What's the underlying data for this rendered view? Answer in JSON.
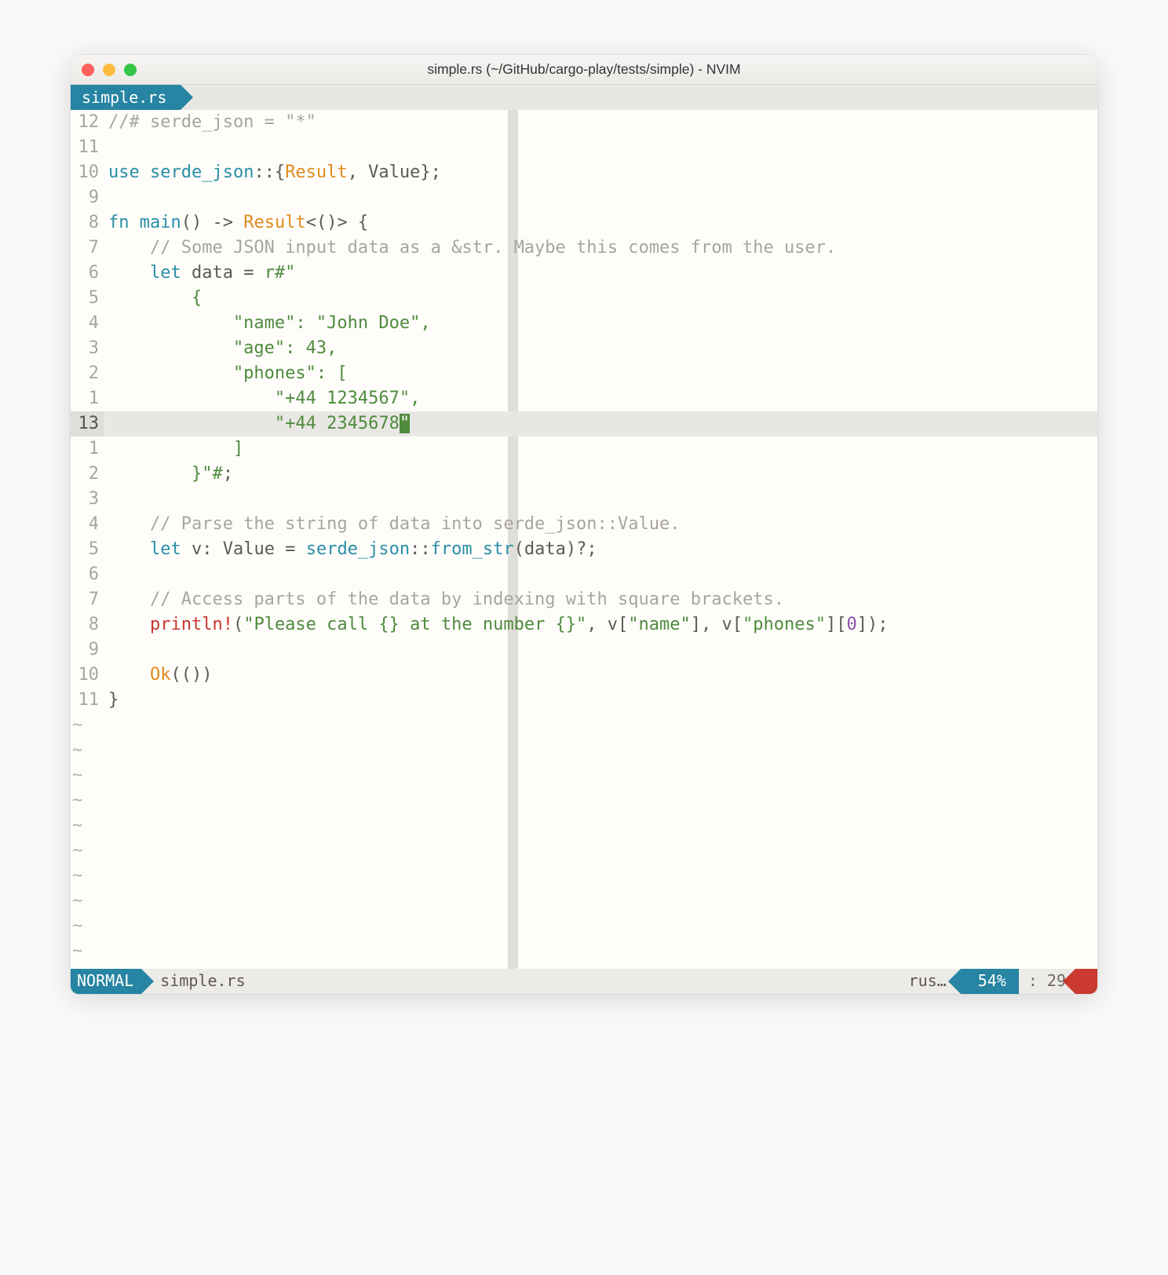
{
  "window": {
    "title": "simple.rs (~/GitHub/cargo-play/tests/simple) - NVIM"
  },
  "tab": {
    "label": "simple.rs"
  },
  "cursor": {
    "line_index": 12,
    "col": 29
  },
  "gutter_numbers": [
    "12",
    "11",
    "10",
    "9",
    "8",
    "7",
    "6",
    "5",
    "4",
    "3",
    "2",
    "1",
    "13",
    "1",
    "2",
    "3",
    "4",
    "5",
    "6",
    "7",
    "8",
    "9",
    "10",
    "11"
  ],
  "tilde_count": 10,
  "statusbar": {
    "mode": "NORMAL",
    "file": "simple.rs",
    "filetype": "rus…",
    "percent": "54%",
    "position": ": 29"
  },
  "code_lines": [
    [
      {
        "t": "//# serde_json = \"*\"",
        "c": "c-gray"
      }
    ],
    [],
    [
      {
        "t": "use ",
        "c": "c-teal"
      },
      {
        "t": "serde_json",
        "c": "c-teal"
      },
      {
        "t": "::{",
        "c": "c-text"
      },
      {
        "t": "Result",
        "c": "c-orange"
      },
      {
        "t": ", ",
        "c": "c-text"
      },
      {
        "t": "Value",
        "c": "c-text"
      },
      {
        "t": "};",
        "c": "c-text"
      }
    ],
    [],
    [
      {
        "t": "fn ",
        "c": "c-teal"
      },
      {
        "t": "main",
        "c": "c-teal"
      },
      {
        "t": "() -> ",
        "c": "c-text"
      },
      {
        "t": "Result",
        "c": "c-orange"
      },
      {
        "t": "<()> {",
        "c": "c-text"
      }
    ],
    [
      {
        "t": "    ",
        "c": ""
      },
      {
        "t": "// Some JSON input data as a &str. Maybe this comes from the user.",
        "c": "c-gray"
      }
    ],
    [
      {
        "t": "    ",
        "c": ""
      },
      {
        "t": "let ",
        "c": "c-teal"
      },
      {
        "t": "data = ",
        "c": "c-text"
      },
      {
        "t": "r#\"",
        "c": "c-green"
      }
    ],
    [
      {
        "t": "        {",
        "c": "c-green"
      }
    ],
    [
      {
        "t": "            \"name\": \"John Doe\",",
        "c": "c-green"
      }
    ],
    [
      {
        "t": "            \"age\": 43,",
        "c": "c-green"
      }
    ],
    [
      {
        "t": "            \"phones\": [",
        "c": "c-green"
      }
    ],
    [
      {
        "t": "                \"+44 1234567\",",
        "c": "c-green"
      }
    ],
    [
      {
        "t": "                \"+44 2345678",
        "c": "c-green"
      },
      {
        "t": "\"",
        "c": "cursor"
      }
    ],
    [
      {
        "t": "            ]",
        "c": "c-green"
      }
    ],
    [
      {
        "t": "        }\"#",
        "c": "c-green"
      },
      {
        "t": ";",
        "c": "c-text"
      }
    ],
    [],
    [
      {
        "t": "    ",
        "c": ""
      },
      {
        "t": "// Parse the string of data into serde_json::Value.",
        "c": "c-gray"
      }
    ],
    [
      {
        "t": "    ",
        "c": ""
      },
      {
        "t": "let ",
        "c": "c-teal"
      },
      {
        "t": "v: ",
        "c": "c-text"
      },
      {
        "t": "Value",
        "c": "c-text"
      },
      {
        "t": " = ",
        "c": "c-text"
      },
      {
        "t": "serde_json",
        "c": "c-teal"
      },
      {
        "t": "::",
        "c": "c-text"
      },
      {
        "t": "from_str",
        "c": "c-teal"
      },
      {
        "t": "(data)?;",
        "c": "c-text"
      }
    ],
    [],
    [
      {
        "t": "    ",
        "c": ""
      },
      {
        "t": "// Access parts of the data by indexing with square brackets.",
        "c": "c-gray"
      }
    ],
    [
      {
        "t": "    ",
        "c": ""
      },
      {
        "t": "println!",
        "c": "c-red"
      },
      {
        "t": "(",
        "c": "c-text"
      },
      {
        "t": "\"Please call {} at the number {}\"",
        "c": "c-green"
      },
      {
        "t": ", v[",
        "c": "c-text"
      },
      {
        "t": "\"name\"",
        "c": "c-green"
      },
      {
        "t": "], v[",
        "c": "c-text"
      },
      {
        "t": "\"phones\"",
        "c": "c-green"
      },
      {
        "t": "][",
        "c": "c-text"
      },
      {
        "t": "0",
        "c": "c-purple"
      },
      {
        "t": "]);",
        "c": "c-text"
      }
    ],
    [],
    [
      {
        "t": "    ",
        "c": ""
      },
      {
        "t": "Ok",
        "c": "c-orange"
      },
      {
        "t": "(())",
        "c": "c-text"
      }
    ],
    [
      {
        "t": "}",
        "c": "c-text"
      }
    ]
  ]
}
